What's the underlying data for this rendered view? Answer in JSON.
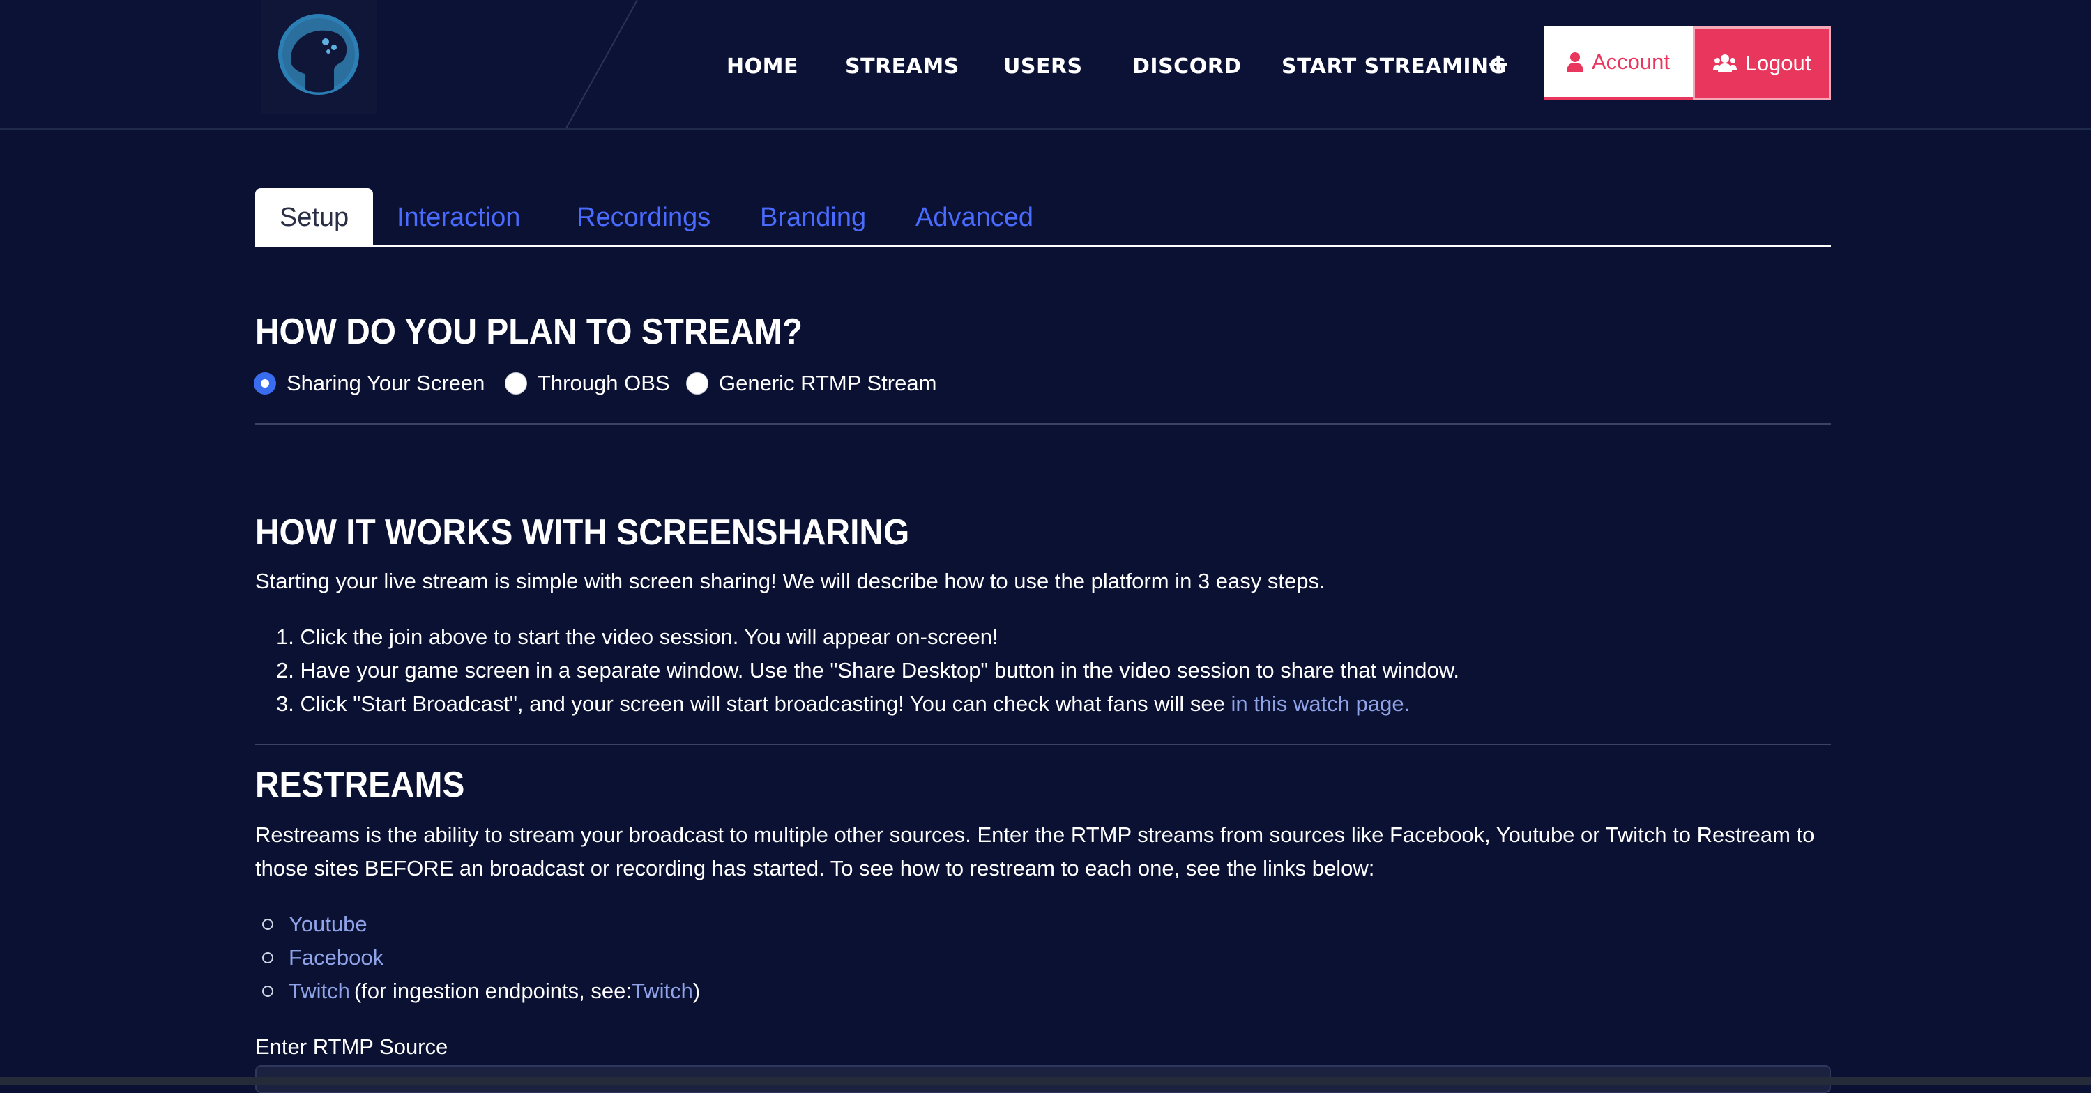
{
  "nav": {
    "links": [
      "HOME",
      "STREAMS",
      "USERS",
      "DISCORD",
      "START STREAMING"
    ],
    "start_plus": "+",
    "account_label": "Account",
    "logout_label": "Logout"
  },
  "tabs": [
    "Setup",
    "Interaction",
    "Recordings",
    "Branding",
    "Advanced"
  ],
  "plan": {
    "heading": "HOW DO YOU PLAN TO STREAM?",
    "options": [
      "Sharing Your Screen",
      "Through OBS",
      "Generic RTMP Stream"
    ],
    "selected": "Sharing Your Screen"
  },
  "how": {
    "heading": "HOW IT WORKS WITH SCREENSHARING",
    "intro": "Starting your live stream is simple with screen sharing! We will describe how to use the platform in 3 easy steps.",
    "steps": [
      "1. Click the join above to start the video session. You will appear on-screen!",
      "2. Have your game screen in a separate window. Use the \"Share Desktop\" button in the video session to share that window.",
      "3. Click \"Start Broadcast\", and your screen will start broadcasting! You can check what fans will see "
    ],
    "watch_link": "in this watch page."
  },
  "restreams": {
    "heading": "RESTREAMS",
    "desc_line1": "Restreams is the ability to stream your broadcast to multiple other sources. Enter the RTMP streams from sources like Facebook, Youtube or Twitch to Restream to",
    "desc_line2": "those sites BEFORE an broadcast or recording has started. To see how to restream to each one, see the links below:",
    "links": [
      "Youtube",
      "Facebook",
      "Twitch"
    ],
    "twitch_note_prefix": "(for ingestion endpoints, see: ",
    "twitch_note_link": "Twitch",
    "twitch_note_suffix": ")",
    "input_label": "Enter RTMP Source"
  },
  "colors": {
    "background": "#0b1133",
    "accent": "#e8365d",
    "tab_link": "#4a6bff",
    "link": "#8fa3e8",
    "radio_checked": "#3a6cf0"
  }
}
